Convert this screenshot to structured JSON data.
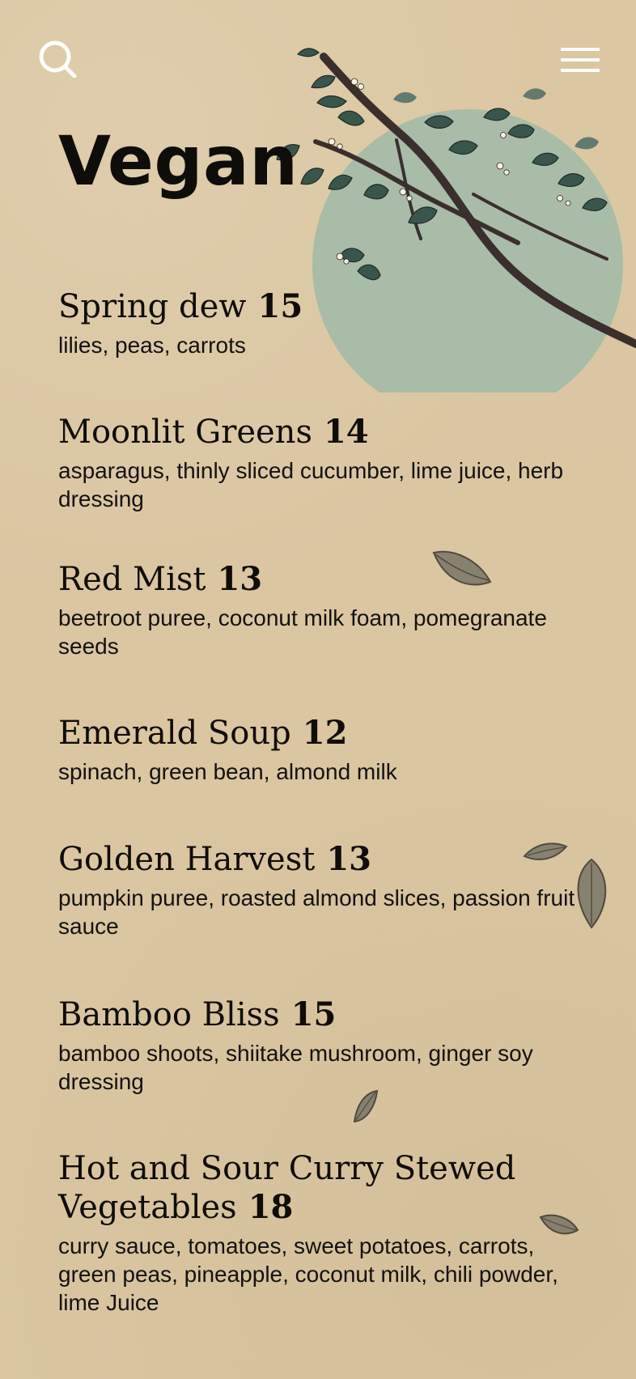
{
  "header": {
    "search_icon": "search-icon",
    "menu_icon": "menu-icon"
  },
  "page": {
    "title": "Vegan"
  },
  "menu": [
    {
      "name": "Spring dew",
      "price": "15",
      "desc": "lilies, peas, carrots"
    },
    {
      "name": "Moonlit Greens",
      "price": "14",
      "desc": "asparagus, thinly sliced cucumber, lime juice, herb dressing"
    },
    {
      "name": "Red Mist",
      "price": "13",
      "desc": "beetroot puree, coconut milk foam, pomegranate seeds"
    },
    {
      "name": "Emerald Soup",
      "price": "12",
      "desc": "spinach, green bean, almond milk"
    },
    {
      "name": "Golden Harvest",
      "price": "13",
      "desc": "pumpkin puree, roasted almond slices, passion fruit sauce"
    },
    {
      "name": "Bamboo Bliss",
      "price": "15",
      "desc": "bamboo shoots, shiitake mushroom, ginger soy dressing"
    },
    {
      "name": "Hot and Sour Curry Stewed Vegetables",
      "price": "18",
      "desc": "curry sauce, tomatoes, sweet potatoes, carrots, green peas, pineapple, coconut milk, chili powder, lime Juice"
    }
  ],
  "colors": {
    "background": "#dcc8a3",
    "text": "#0f0d0a",
    "moon": "#a8bca7",
    "leaf_dark": "#39564d",
    "leaf_mid": "#55716a",
    "stem": "#3a2f2d"
  }
}
